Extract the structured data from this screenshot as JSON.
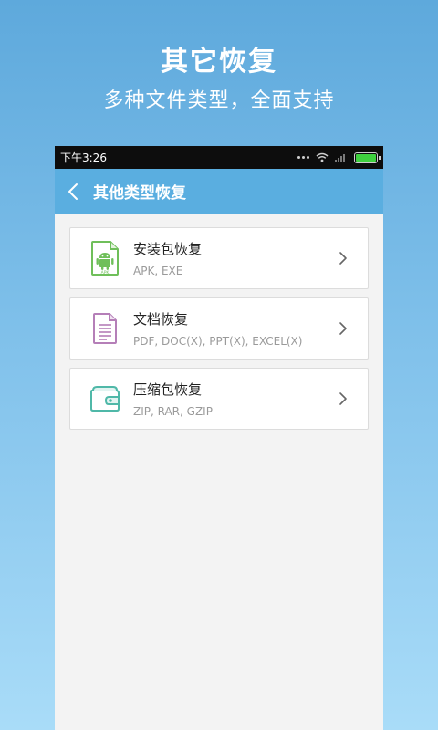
{
  "promo": {
    "title": "其它恢复",
    "subtitle": "多种文件类型，全面支持"
  },
  "status_bar": {
    "time": "下午3:26",
    "battery_level": 1.0,
    "icons": [
      "more-dots-icon",
      "wifi-icon",
      "signal-icon",
      "battery-icon"
    ]
  },
  "app_bar": {
    "back_icon": "chevron-left-icon",
    "title": "其他类型恢复"
  },
  "items": [
    {
      "title": "安装包恢复",
      "subtitle": "APK, EXE",
      "icon": "apk-file-icon",
      "icon_label": "APK"
    },
    {
      "title": "文档恢复",
      "subtitle": "PDF, DOC(X), PPT(X), EXCEL(X)",
      "icon": "document-icon"
    },
    {
      "title": "压缩包恢复",
      "subtitle": "ZIP, RAR, GZIP",
      "icon": "archive-icon"
    }
  ],
  "colors": {
    "app_bar": "#5aaee0",
    "apk_icon": "#6fbf5a",
    "document_icon": "#b57fb8",
    "archive_icon": "#4fb8a8"
  }
}
